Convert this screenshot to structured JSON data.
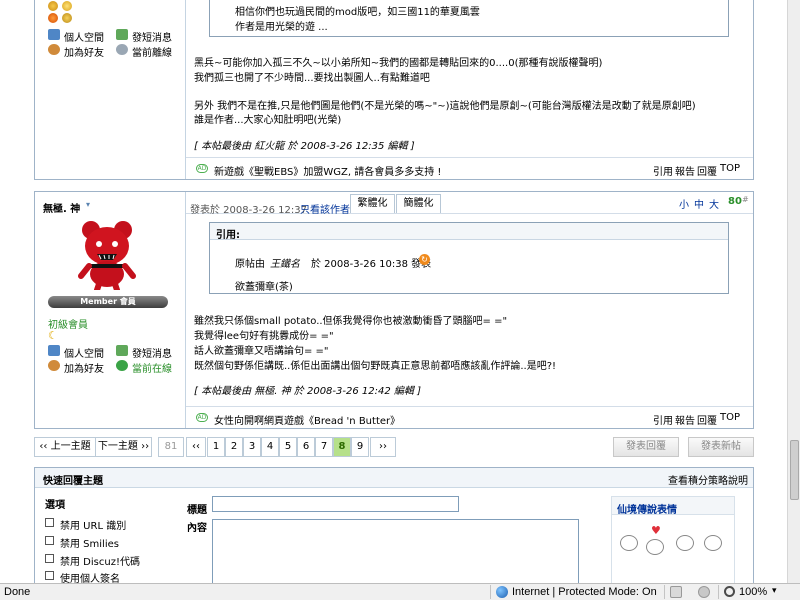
{
  "post1": {
    "quote_line1": "相信你們也玩過民間的mod版吧，如三國11的華夏風雲",
    "quote_line2": "作者是用光榮的遊 ...",
    "body": [
      "黑兵~可能你加入孤三不久~以小弟所知~我們的國都是轉貼回來的0....0(那種有說版權聲明)",
      "我們孤三也開了不少時間...要找出製圖人..有點難道吧",
      "另外 我們不是在推,只是他們圖是他們(不是光榮的嗎~\"~)這說他們是原創~(可能台灣版權法是改動了就是原創吧)",
      "誰是作者...大家心知肚明吧(光榮)"
    ],
    "edit_note": "[ 本帖最後由 紅火龍 於 2008-3-26 12:35 編輯 ]",
    "profile_links": [
      "個人空間",
      "發短消息",
      "加為好友",
      "當前離線"
    ],
    "ad_text": "新遊戲《聖戰EBS》加盟WGZ, 請各會員多多支持 !",
    "actions": [
      "引用",
      "報告",
      "回覆",
      "TOP"
    ]
  },
  "post2": {
    "username": "無極. 神",
    "post_time": "發表於 2008-3-26 12:37",
    "only_author": "只看該作者",
    "tab_trad": "繁體化",
    "tab_simp": "簡體化",
    "font_sizes": [
      "小",
      "中",
      "大"
    ],
    "floor": "80",
    "floor_suffix": "#",
    "member_label": "Member 會員",
    "rank": "初級會員",
    "profile_links": [
      "個人空間",
      "發短消息",
      "加為好友",
      "當前在線"
    ],
    "quote_title": "引用:",
    "quote_src_prefix": "原帖由",
    "quote_src_user": "王鐵名",
    "quote_src_time": "於 2008-3-26 10:38 發表",
    "quote_body": "欲蓋彌章(茶)",
    "body": [
      "雖然我只係個small potato..但係我覺得你也被激動衝昏了頭腦吧= =\"",
      "我覺得lee句好有挑釁成份= =\"",
      "話人欲蓋彌章又唔講論句= =\"",
      "既然個句野係佢講既..係佢出面講出個句野既真正意思前都唔應該亂作評論..是吧?!"
    ],
    "edit_note": "[ 本帖最後由 無極. 神 於 2008-3-26 12:42 編輯 ]",
    "ad_text": "女性向開啊網頁遊戲《Bread 'n Butter》",
    "actions": [
      "引用",
      "報告",
      "回覆",
      "TOP"
    ]
  },
  "pagination": {
    "prev_topic": "‹‹ 上一主題",
    "next_topic": "下一主題 ››",
    "first": "81",
    "prev": "‹‹",
    "pages": [
      "1",
      "2",
      "3",
      "4",
      "5",
      "6",
      "7",
      "8",
      "9"
    ],
    "current": "8",
    "next": "››",
    "reply_btn": "發表回覆",
    "new_btn": "發表新帖"
  },
  "quick_reply": {
    "title": "快速回覆主題",
    "help": "查看積分策略說明",
    "options_label": "選項",
    "options": [
      "禁用 URL 識別",
      "禁用 Smilies",
      "禁用 Discuz!代碼",
      "使用個人簽名"
    ],
    "subject_label": "標題",
    "content_label": "內容",
    "smilies_title": "仙境傳說表情"
  },
  "statusbar": {
    "left": "Done",
    "zone": "Internet | Protected Mode: On",
    "zoom": "100%"
  },
  "colors": {
    "border": "#9fb3c8",
    "link": "#003399",
    "floor_green": "#2a8f2a",
    "current_page": "#b6e08a"
  }
}
